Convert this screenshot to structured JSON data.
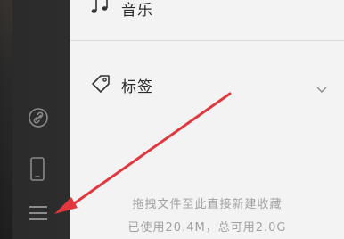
{
  "panel": {
    "items": [
      {
        "label": "音乐",
        "icon": "music-note-icon"
      },
      {
        "label": "标签",
        "icon": "tag-icon"
      }
    ],
    "info": {
      "drag_hint": "拖拽文件至此直接新建收藏",
      "storage": "已使用20.4M，总可用2.0G"
    }
  },
  "sidebar": {
    "icons": [
      "link-icon",
      "phone-icon",
      "menu-icon"
    ]
  },
  "colors": {
    "sidebar_bg": "#2d2d2d",
    "panel_bg": "#f3f3f3",
    "annotation_arrow": "#e0383e"
  }
}
